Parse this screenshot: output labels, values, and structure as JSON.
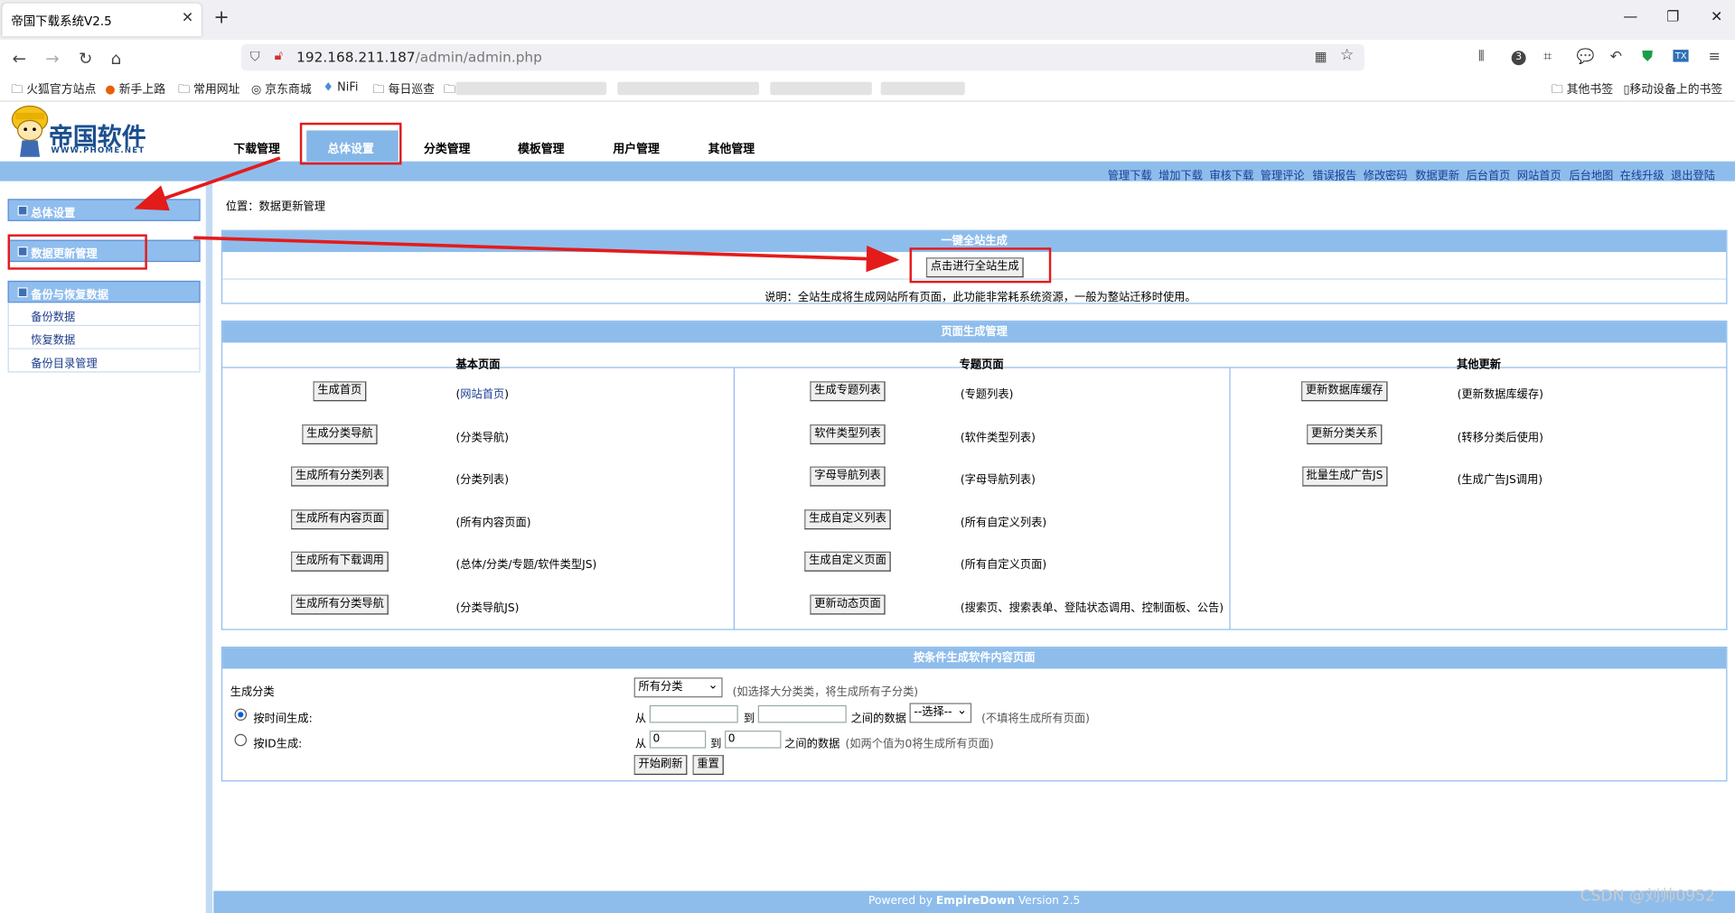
{
  "browser": {
    "tab_title": "帝国下载系统V2.5",
    "url_host": "192.168.211.187",
    "url_path": "/admin/admin.php",
    "bookmarks": [
      "火狐官方站点",
      "新手上路",
      "常用网址",
      "京东商城",
      "NiFi",
      "每日巡查"
    ],
    "bookmarks_right": [
      "其他书签",
      "移动设备上的书签"
    ]
  },
  "logo": {
    "name": "帝国软件",
    "url": "WWW.PHOME.NET"
  },
  "top_nav": [
    "下载管理",
    "总体设置",
    "分类管理",
    "模板管理",
    "用户管理",
    "其他管理"
  ],
  "quick_links": [
    "管理下载",
    "增加下载",
    "审核下载",
    "管理评论",
    "错误报告",
    "修改密码",
    "数据更新",
    "后台首页",
    "网站首页",
    "后台地图",
    "在线升级",
    "退出登陆"
  ],
  "sidebar": {
    "sections": [
      {
        "title": "总体设置"
      },
      {
        "title": "数据更新管理"
      },
      {
        "title": "备份与恢复数据",
        "items": [
          "备份数据",
          "恢复数据",
          "备份目录管理"
        ]
      }
    ]
  },
  "main": {
    "location": "位置：数据更新管理",
    "one_click": {
      "title": "一键全站生成",
      "button": "点击进行全站生成",
      "note": "说明：全站生成将生成网站所有页面，此功能非常耗系统资源，一般为整站迁移时使用。"
    },
    "page_gen": {
      "title": "页面生成管理",
      "col1": {
        "header": "基本页面",
        "rows": [
          {
            "btn": "生成首页",
            "pre": "(",
            "link": "网站首页",
            "post": ")"
          },
          {
            "btn": "生成分类导航",
            "desc": "(分类导航)"
          },
          {
            "btn": "生成所有分类列表",
            "desc": "(分类列表)"
          },
          {
            "btn": "生成所有内容页面",
            "desc": "(所有内容页面)"
          },
          {
            "btn": "生成所有下载调用",
            "desc": "(总体/分类/专题/软件类型JS)"
          },
          {
            "btn": "生成所有分类导航",
            "desc": "(分类导航JS)"
          }
        ]
      },
      "col2": {
        "header": "专题页面",
        "rows": [
          {
            "btn": "生成专题列表",
            "desc": "(专题列表)"
          },
          {
            "btn": "软件类型列表",
            "desc": "(软件类型列表)"
          },
          {
            "btn": "字母导航列表",
            "desc": "(字母导航列表)"
          },
          {
            "btn": "生成自定义列表",
            "desc": "(所有自定义列表)"
          },
          {
            "btn": "生成自定义页面",
            "desc": "(所有自定义页面)"
          },
          {
            "btn": "更新动态页面",
            "desc": "(搜索页、搜索表单、登陆状态调用、控制面板、公告)"
          }
        ]
      },
      "col3": {
        "header": "其他更新",
        "rows": [
          {
            "btn": "更新数据库缓存",
            "desc": "(更新数据库缓存)"
          },
          {
            "btn": "更新分类关系",
            "desc": "(转移分类后使用)"
          },
          {
            "btn": "批量生成广告JS",
            "desc": "(生成广告JS调用)"
          }
        ]
      }
    },
    "cond_gen": {
      "title": "按条件生成软件内容页面",
      "class_label": "生成分类",
      "class_select": "所有分类",
      "class_hint": "(如选择大分类类，将生成所有子分类)",
      "by_time_label": "按时间生成:",
      "from": "从",
      "to": "到",
      "between": "之间的数据",
      "time_select": "--选择--",
      "time_hint": "(不填将生成所有页面)",
      "by_id_label": "按ID生成:",
      "id_from_value": "0",
      "id_to_value": "0",
      "id_hint": "(如两个值为0将生成所有页面)",
      "start_btn": "开始刷新",
      "reset_btn": "重置"
    }
  },
  "footer": {
    "prefix": "Powered by ",
    "brand": "EmpireDown",
    "suffix": " Version 2.5"
  },
  "watermark": "CSDN @刘帅0952",
  "colors": {
    "header_blue": "#8ebdec",
    "annotation_red": "#e41b1b",
    "link_blue": "#1c3f94"
  }
}
